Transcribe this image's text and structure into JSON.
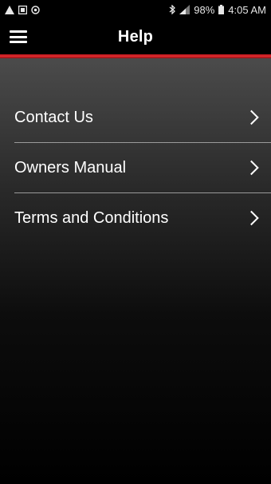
{
  "status_bar": {
    "left_icons": [
      "warning-icon",
      "image-icon",
      "sync-icon"
    ],
    "bluetooth_icon": "bluetooth-icon",
    "signal_icon": "signal-icon",
    "battery_percent": "98%",
    "battery_icon": "battery-icon",
    "time": "4:05 AM"
  },
  "app_bar": {
    "menu_icon": "hamburger-menu-icon",
    "title": "Help"
  },
  "accent_color": "#d8262b",
  "menu": {
    "items": [
      {
        "label": "Contact Us",
        "icon": "chevron-right-icon"
      },
      {
        "label": "Owners Manual",
        "icon": "chevron-right-icon"
      },
      {
        "label": "Terms and Conditions",
        "icon": "chevron-right-icon"
      }
    ]
  }
}
